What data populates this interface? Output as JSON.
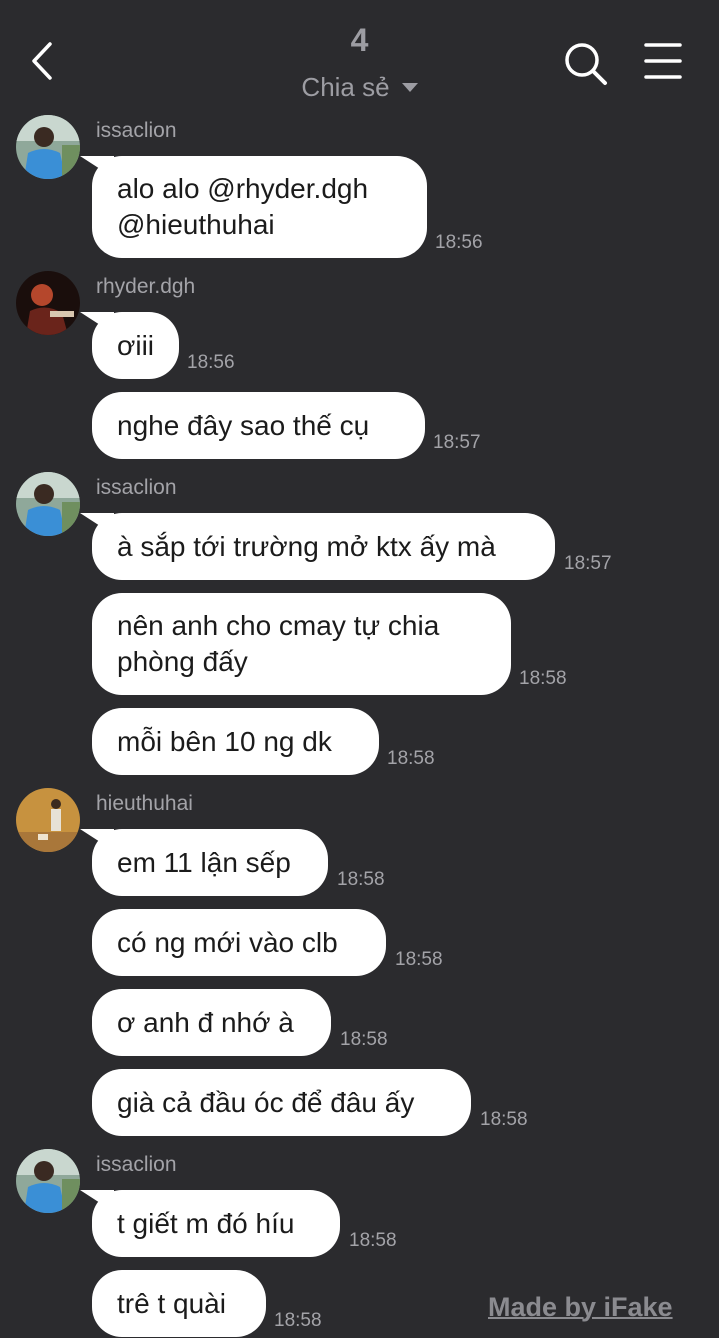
{
  "header": {
    "title": "4",
    "subtitle": "Chia sẻ",
    "back_icon": "chevron-left-icon",
    "search_icon": "search-icon",
    "menu_icon": "menu-icon"
  },
  "messages": [
    {
      "sender": "issaclion",
      "text": "alo alo @rhyder.dgh\n@hieuthuhai",
      "time": "18:56"
    },
    {
      "sender": "rhyder.dgh",
      "text": "ơiii",
      "time": "18:56"
    },
    {
      "text": "nghe đây sao thế cụ",
      "time": "18:57"
    },
    {
      "sender": "issaclion",
      "text": "à sắp tới trường mở ktx ấy mà",
      "time": "18:57"
    },
    {
      "text": "nên anh cho cmay tự chia\nphòng đấy",
      "time": "18:58"
    },
    {
      "text": "mỗi bên 10 ng dk",
      "time": "18:58"
    },
    {
      "sender": "hieuthuhai",
      "text": "em 11 lận sếp",
      "time": "18:58"
    },
    {
      "text": "có ng mới vào clb",
      "time": "18:58"
    },
    {
      "text": "ơ anh đ nhớ à",
      "time": "18:58"
    },
    {
      "text": "già cả đầu óc để đâu ấy",
      "time": "18:58"
    },
    {
      "sender": "issaclion",
      "text": "t giết m đó híu",
      "time": "18:58"
    },
    {
      "text": "trê t quài",
      "time": "18:58"
    }
  ],
  "watermark": "Made by iFake",
  "colors": {
    "background": "#2b2b2e",
    "bubble": "#ffffff",
    "muted": "#a3a3a8"
  }
}
